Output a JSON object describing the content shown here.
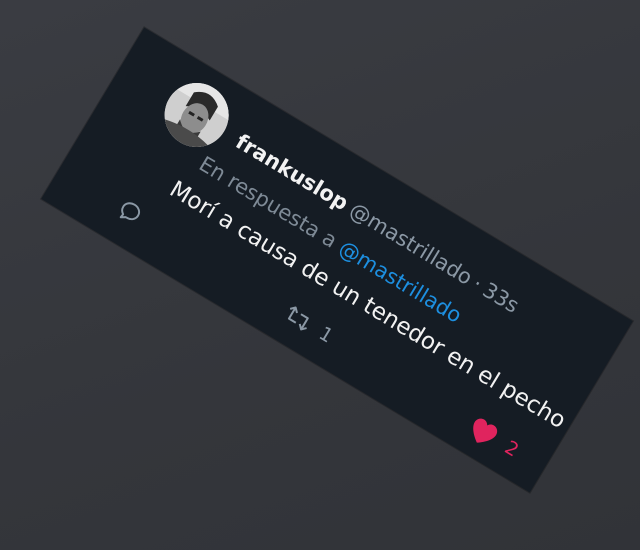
{
  "tweet": {
    "user_name": "frankuslop",
    "handle": "@mastrillado",
    "separator": "·",
    "time": "33s",
    "reply_prefix": "En respuesta a",
    "reply_to": "@mastrillado",
    "text": "Morí a causa de un tenedor en el pecho"
  },
  "actions": {
    "reply_icon": "reply-bubble-icon",
    "retweet_icon": "retweet-icon",
    "retweet_count": "1",
    "like_icon": "heart-icon",
    "like_count": "2"
  },
  "colors": {
    "background": "#36383e",
    "card": "#151c24",
    "text": "#f2f2f2",
    "muted": "#8b98a5",
    "mention": "#1d8fe0",
    "like": "#e0245e"
  }
}
